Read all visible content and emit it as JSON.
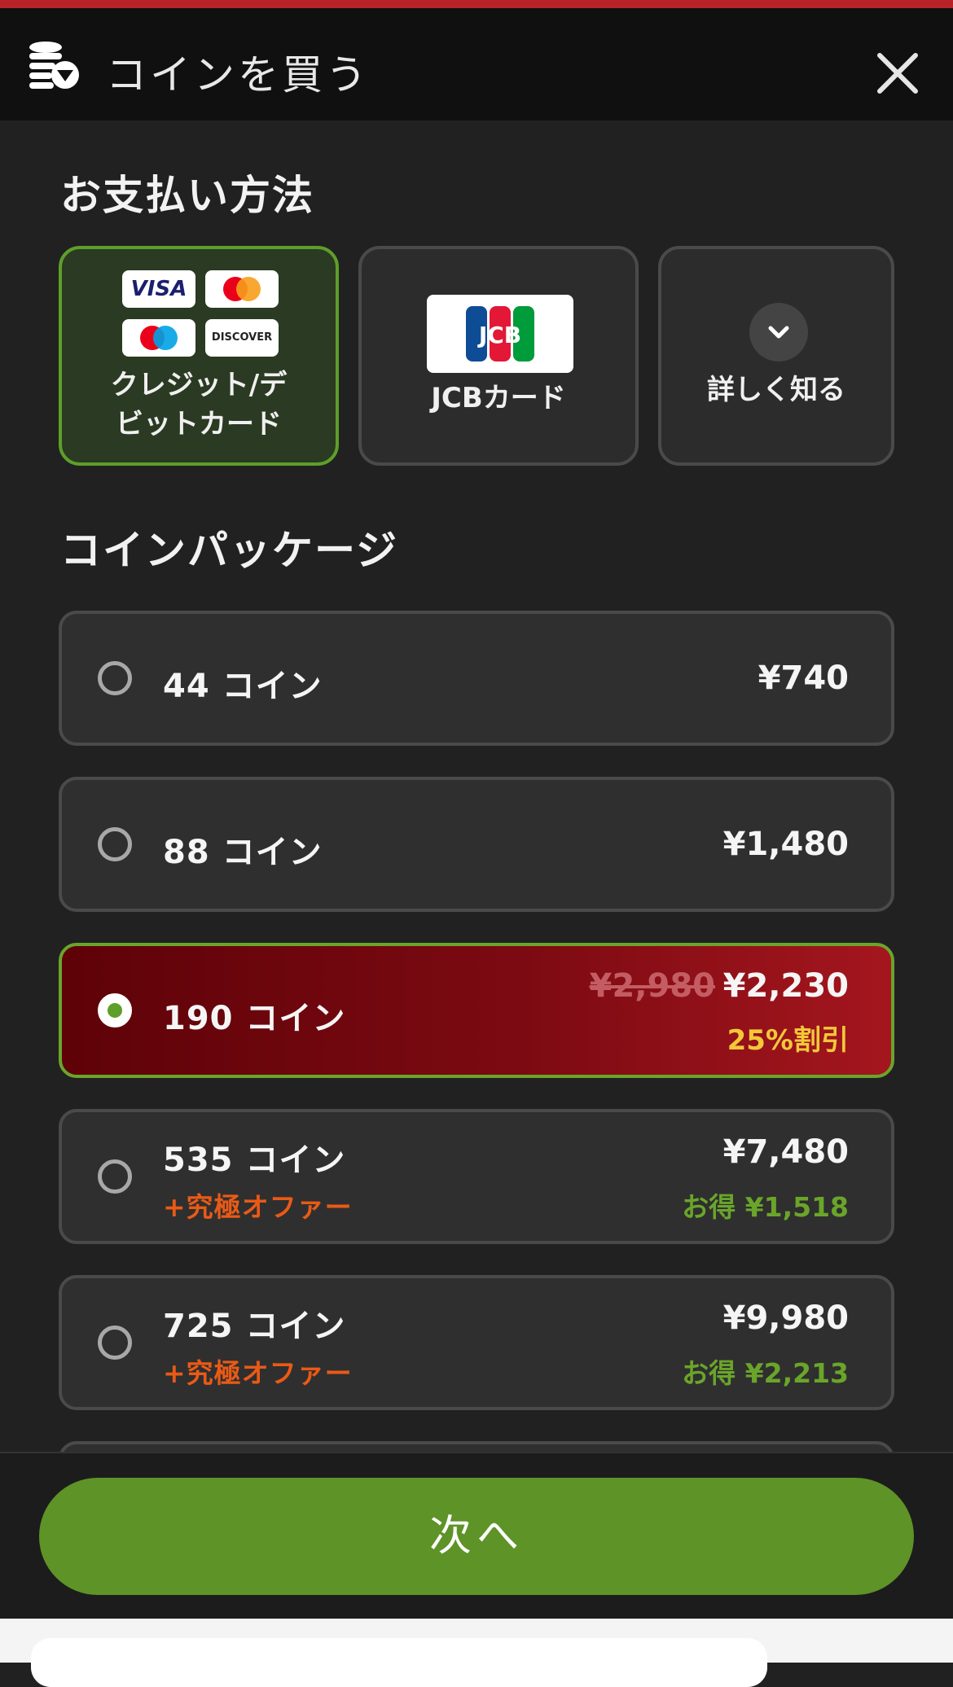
{
  "header": {
    "title": "コインを買う",
    "icon": "coin-stack-icon",
    "close_icon": "close-icon"
  },
  "payment": {
    "heading": "お支払い方法",
    "methods": [
      {
        "label_line1": "クレジット/デ",
        "label_line2": "ビットカード",
        "logos": [
          "VISA",
          "mastercard",
          "maestro",
          "DISCOVER"
        ],
        "selected": true
      },
      {
        "label": "JCBカード",
        "logo": "JCB",
        "selected": false
      },
      {
        "label": "詳しく知る",
        "icon": "chevron-down-icon",
        "selected": false
      }
    ]
  },
  "packages": {
    "heading": "コインパッケージ",
    "items": [
      {
        "coins": "44 コイン",
        "price": "¥740"
      },
      {
        "coins": "88 コイン",
        "price": "¥1,480"
      },
      {
        "coins": "190 コイン",
        "old_price": "¥2,980",
        "price": "¥2,230",
        "discount": "25%割引",
        "selected": true
      },
      {
        "coins": "535 コイン",
        "offer": "+究極オファー",
        "price": "¥7,480",
        "saving": "お得 ¥1,518"
      },
      {
        "coins": "725 コイン",
        "offer": "+究極オファー",
        "price": "¥9,980",
        "saving": "お得 ¥2,213"
      }
    ]
  },
  "footer": {
    "next_label": "次へ"
  },
  "colors": {
    "accent_green": "#5e9327",
    "selected_red": "#7c0a12",
    "offer_orange": "#ea5a16",
    "discount_yellow": "#f2c73a"
  }
}
